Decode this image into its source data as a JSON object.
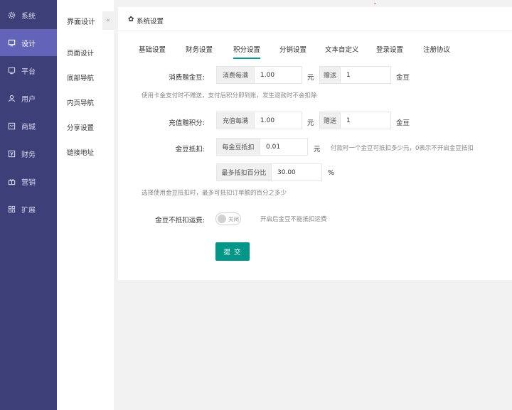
{
  "nav": {
    "items": [
      {
        "label": "系统",
        "icon": "settings-icon"
      },
      {
        "label": "设计",
        "icon": "monitor-icon"
      },
      {
        "label": "平台",
        "icon": "display-icon"
      },
      {
        "label": "用户",
        "icon": "user-icon"
      },
      {
        "label": "商城",
        "icon": "store-icon"
      },
      {
        "label": "财务",
        "icon": "finance-icon"
      },
      {
        "label": "营销",
        "icon": "gift-icon"
      },
      {
        "label": "扩展",
        "icon": "apps-icon"
      }
    ],
    "active_index": 1
  },
  "submenu": {
    "title": "界面设计",
    "collapse_glyph": "«",
    "items": [
      "页面设计",
      "底部导航",
      "内页导航",
      "分享设置",
      "链接地址"
    ]
  },
  "card": {
    "title": "系统设置",
    "tabs": [
      "基础设置",
      "财务设置",
      "积分设置",
      "分销设置",
      "文本自定义",
      "登录设置",
      "注册协议"
    ],
    "active_tab": 2
  },
  "form": {
    "consume": {
      "label": "消费赠金豆:",
      "addon1": "消费每满",
      "value1": "1.00",
      "unit1": "元",
      "addon2": "赠送",
      "value2": "1",
      "unit2": "金豆",
      "hint": "使用卡金支付时不赠送，支付后积分即到账，发生退款时不会扣除"
    },
    "recharge": {
      "label": "充值赠积分:",
      "addon1": "充值每满",
      "value1": "1.00",
      "unit1": "元",
      "addon2": "赠送",
      "value2": "1",
      "unit2": "金豆"
    },
    "deduct": {
      "label": "金豆抵扣:",
      "addon1": "每金豆抵扣",
      "value1": "0.01",
      "unit1": "元",
      "note": "付款时一个金豆可抵扣多少元，0表示不开启金豆抵扣",
      "addon2": "最多抵扣百分比",
      "value2": "30.00",
      "unit2": "%",
      "hint": "选择使用金豆抵扣时，最多可抵扣订单额的百分之多少"
    },
    "freight": {
      "label": "金豆不抵扣运费:",
      "switch_text": "关闭",
      "hint": "开启后金豆不能抵扣运费"
    },
    "submit_label": "提 交"
  },
  "colors": {
    "nav_bg": "#3d3f79",
    "nav_active": "#6164b8",
    "accent": "#009688"
  }
}
